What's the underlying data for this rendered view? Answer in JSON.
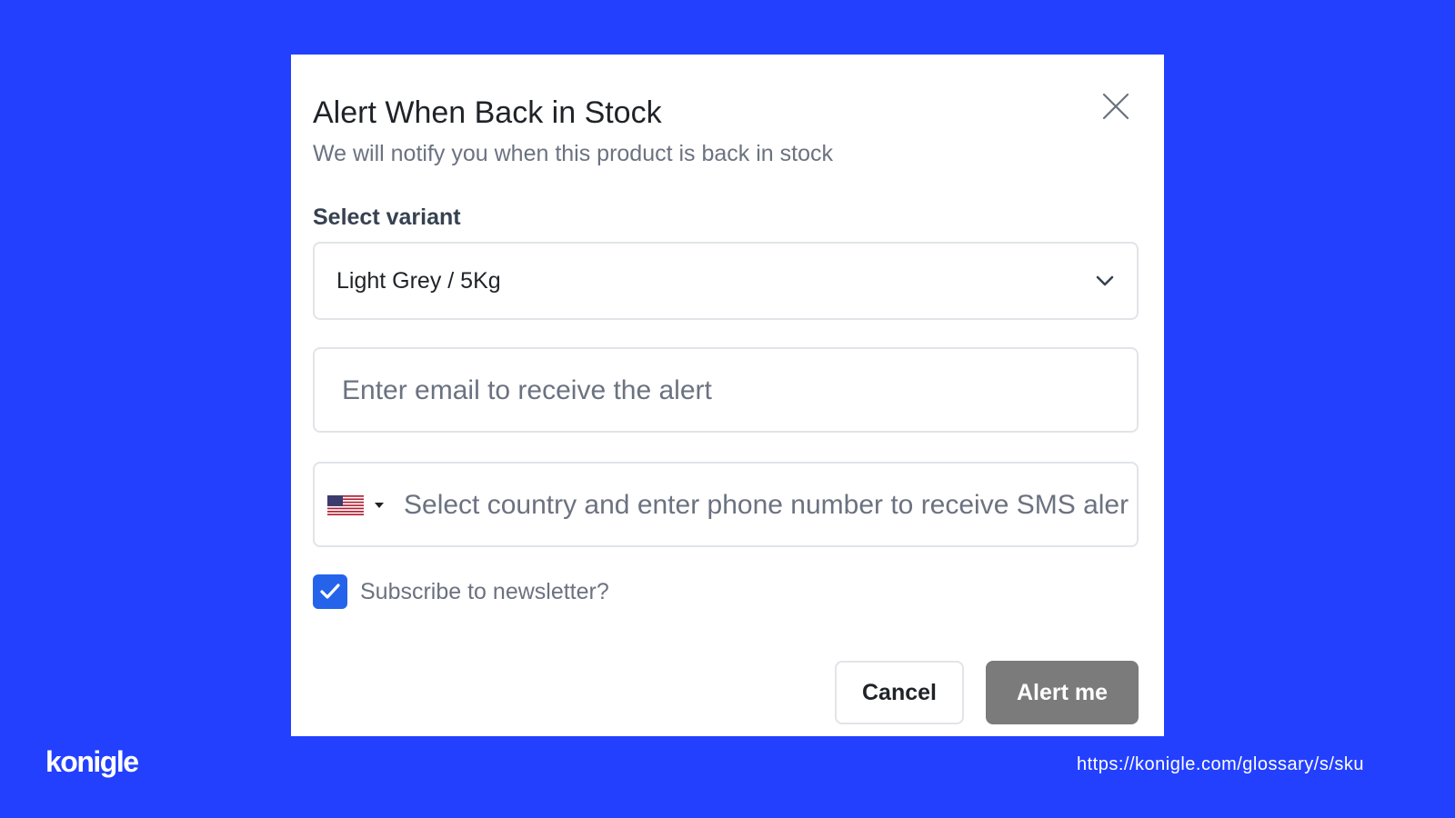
{
  "modal": {
    "title": "Alert When Back in Stock",
    "subtitle": "We will notify you when this product is back in stock",
    "close_icon": "close-icon",
    "variant": {
      "label": "Select variant",
      "selected_value": "Light Grey / 5Kg",
      "icon": "chevron-down-icon"
    },
    "email": {
      "placeholder": "Enter email to receive the alert",
      "value": ""
    },
    "phone": {
      "country_flag": "us-flag-icon",
      "placeholder": "Select country and enter phone number to receive SMS aler",
      "value": ""
    },
    "newsletter": {
      "label": "Subscribe to newsletter?",
      "checked": true
    },
    "buttons": {
      "cancel": "Cancel",
      "submit": "Alert me"
    }
  },
  "brand": {
    "logo_text": "konigle",
    "url": "https://konigle.com/glossary/s/sku"
  },
  "colors": {
    "background": "#2340ff",
    "checkbox": "#2563eb",
    "submit_button": "#7b7b7b"
  }
}
